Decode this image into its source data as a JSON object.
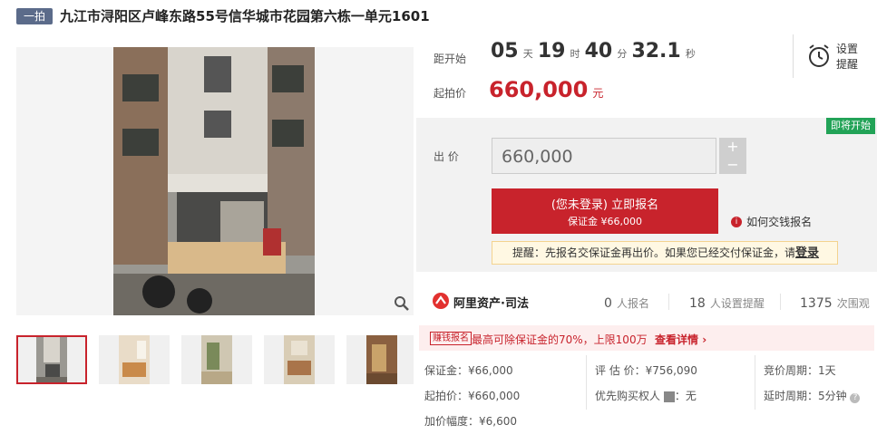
{
  "header": {
    "badge": "一拍",
    "title": "九江市浔阳区卢峰东路55号信华城市花园第六栋一单元1601"
  },
  "countdown": {
    "label": "距开始",
    "days": "05",
    "days_unit": "天",
    "hours": "19",
    "hours_unit": "时",
    "minutes": "40",
    "minutes_unit": "分",
    "seconds": "32.1",
    "seconds_unit": "秒"
  },
  "reminder": {
    "label_line1": "设置",
    "label_line2": "提醒",
    "icon": "alarm-clock-icon"
  },
  "start_price": {
    "label": "起拍价",
    "value": "660,000",
    "unit": "元"
  },
  "status_badge": {
    "label": "即将开始",
    "color": "#22a357"
  },
  "bid": {
    "label": "出 价",
    "value": "660,000",
    "plus": "+",
    "minus": "−"
  },
  "signup": {
    "line1": "(您未登录) 立即报名",
    "line2": "保证金 ¥66,000"
  },
  "how_pay": {
    "label": "如何交钱报名",
    "icon": "info-icon"
  },
  "notice": {
    "text": "提醒：先报名交保证金再出价。如果您已经交付保证金，请",
    "login": "登录"
  },
  "brand": {
    "name": "阿里资产·司法",
    "icon": "ali-asset-logo-icon"
  },
  "stats": [
    {
      "num": "0",
      "label": "人报名"
    },
    {
      "num": "18",
      "label": "人设置提醒"
    },
    {
      "num": "1375",
      "label": "次围观"
    }
  ],
  "promo": {
    "tag": "赚钱报名",
    "text": "最高可除保证金的70%，上限100万",
    "link": "查看详情"
  },
  "details": {
    "deposit": "保证金：¥66,000",
    "appraisal": "评 估 价：¥756,090",
    "cycle": "竞价周期：1天",
    "start": "起拍价：¥660,000",
    "priority_label": "优先购买权人",
    "priority_value": "：无",
    "delay": "延时周期：5分钟",
    "increment": "加价幅度：¥6,600"
  },
  "colors": {
    "accent": "#c8232c",
    "badge_bg": "#5b6b8a",
    "status_green": "#22a357"
  }
}
